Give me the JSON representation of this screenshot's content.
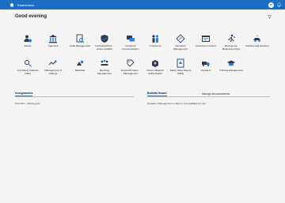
{
  "header": {
    "app_name": "Tradmeduim",
    "user_initials": "TA"
  },
  "greeting": "Good evening",
  "tiles_row1": [
    {
      "label": "Admin",
      "icon": "admin-icon"
    },
    {
      "label": "Agencies",
      "icon": "building-icon"
    },
    {
      "label": "Audit Management",
      "icon": "audit-icon"
    },
    {
      "label": "Corrective/Prev... Action (CAPA)",
      "icon": "shield-icon"
    },
    {
      "label": "Customer Communication",
      "icon": "customer-communication-icon"
    },
    {
      "label": "Customers",
      "icon": "customers-icon"
    },
    {
      "label": "Deviation Management",
      "icon": "deviation-icon"
    },
    {
      "label": "Document Control",
      "icon": "document-control-icon"
    },
    {
      "label": "Emergency Response Plans",
      "icon": "emergency-icon"
    },
    {
      "label": "Incident and Accident",
      "icon": "incident-icon"
    }
  ],
  "tiles_row2": [
    {
      "label": "Job Safety Analysis (JSA)",
      "icon": "jsa-icon"
    },
    {
      "label": "Management of Change",
      "icon": "change-icon"
    },
    {
      "label": "Materials",
      "icon": "materials-icon"
    },
    {
      "label": "Meetings Management",
      "icon": "meetings-icon"
    },
    {
      "label": "Nonconformanc... Management",
      "icon": "nonconformance-icon"
    },
    {
      "label": "Return Material Authorization",
      "icon": "return-material-icon"
    },
    {
      "label": "Safety Data Sheets (SDS)",
      "icon": "sds-icon"
    },
    {
      "label": "Suppliers",
      "icon": "suppliers-icon"
    },
    {
      "label": "Training Management",
      "icon": "training-icon"
    }
  ],
  "assignments": {
    "title": "Assignments",
    "items": [
      "CVA SKU - Missing part"
    ]
  },
  "bulletin": {
    "title": "Bulletin Board",
    "manage_link": "Manage Announcements",
    "items": [
      "Deviation Management module is now available for use."
    ]
  },
  "colors": {
    "brand": "#1a6fc4",
    "icon_fill": "#2f3b4c",
    "accent": "#2a7de1"
  }
}
